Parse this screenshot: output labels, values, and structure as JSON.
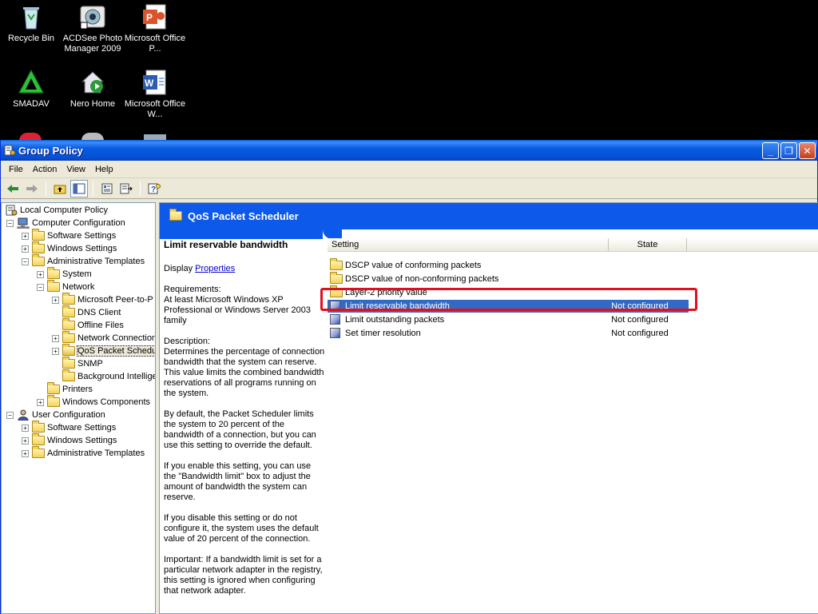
{
  "desktop": {
    "icons": [
      {
        "label": "Recycle Bin"
      },
      {
        "label": "ACDSee Photo Manager 2009"
      },
      {
        "label": "Microsoft Office P..."
      },
      {
        "label": "SMADAV"
      },
      {
        "label": "Nero Home"
      },
      {
        "label": "Microsoft Office W..."
      }
    ]
  },
  "window": {
    "title": "Group Policy",
    "buttons": {
      "minimize": "_",
      "maximize": "❐",
      "close": "✕"
    }
  },
  "menu": [
    "File",
    "Action",
    "View",
    "Help"
  ],
  "tree": {
    "items": [
      {
        "label": "Local Computer Policy",
        "expander": ""
      },
      {
        "label": "Computer Configuration",
        "expander": "−"
      },
      {
        "label": "Software Settings",
        "expander": "+"
      },
      {
        "label": "Windows Settings",
        "expander": "+"
      },
      {
        "label": "Administrative Templates",
        "expander": "−"
      },
      {
        "label": "System",
        "expander": "+"
      },
      {
        "label": "Network",
        "expander": "−"
      },
      {
        "label": "Microsoft Peer-to-P",
        "expander": "+"
      },
      {
        "label": "DNS Client",
        "expander": ""
      },
      {
        "label": "Offline Files",
        "expander": ""
      },
      {
        "label": "Network Connection",
        "expander": "+"
      },
      {
        "label": "QoS Packet Schedu",
        "expander": "+"
      },
      {
        "label": "SNMP",
        "expander": ""
      },
      {
        "label": "Background Intellige",
        "expander": ""
      },
      {
        "label": "Printers",
        "expander": ""
      },
      {
        "label": "Windows Components",
        "expander": "+"
      },
      {
        "label": "User Configuration",
        "expander": "−"
      },
      {
        "label": "Software Settings",
        "expander": "+"
      },
      {
        "label": "Windows Settings",
        "expander": "+"
      },
      {
        "label": "Administrative Templates",
        "expander": "+"
      }
    ]
  },
  "header": {
    "title": "QoS Packet Scheduler"
  },
  "description": {
    "title": "Limit reservable bandwidth",
    "display_prefix": "Display ",
    "display_link": "Properties",
    "requirements": "Requirements:\nAt least Microsoft Windows XP Professional or Windows Server 2003 family",
    "description": "Description:\nDetermines the percentage of connection bandwidth that the system can reserve. This value limits the combined bandwidth reservations of all programs running on the system.",
    "p_default": "By default, the Packet Scheduler limits the system to 20 percent of the bandwidth of a connection, but you can use this setting to override the default.",
    "p_enable": "If you enable this setting, you can use the \"Bandwidth limit\" box to adjust the amount of bandwidth the system can reserve.",
    "p_disable": "If you disable this setting or do not configure it, the system uses the default value of 20 percent of the connection.",
    "p_important": "Important: If a bandwidth limit is set for a particular network adapter in the registry, this setting is ignored when configuring that network adapter."
  },
  "list": {
    "columns": {
      "setting": "Setting",
      "state": "State"
    },
    "rows": [
      {
        "name": "DSCP value of conforming packets",
        "state": ""
      },
      {
        "name": "DSCP value of non-conforming packets",
        "state": ""
      },
      {
        "name": "Layer-2 priority value",
        "state": ""
      },
      {
        "name": "Limit reservable bandwidth",
        "state": "Not configured"
      },
      {
        "name": "Limit outstanding packets",
        "state": "Not configured"
      },
      {
        "name": "Set timer resolution",
        "state": "Not configured"
      }
    ]
  }
}
